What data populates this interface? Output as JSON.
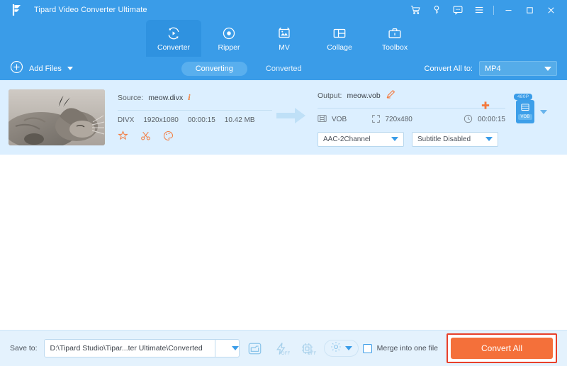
{
  "window": {
    "app_title": "Tipard Video Converter Ultimate",
    "logo_icon": "tipard-logo-icon",
    "controls": [
      {
        "name": "cart-icon",
        "glyph": "cart"
      },
      {
        "name": "key-icon",
        "glyph": "key"
      },
      {
        "name": "feedback-icon",
        "glyph": "chat"
      },
      {
        "name": "menu-icon",
        "glyph": "hamburger"
      },
      {
        "name": "minimize-icon",
        "glyph": "minimize"
      },
      {
        "name": "maximize-icon",
        "glyph": "maximize"
      },
      {
        "name": "close-icon",
        "glyph": "close"
      }
    ]
  },
  "nav": {
    "tabs": [
      {
        "label": "Converter",
        "icon": "converter-icon",
        "active": true
      },
      {
        "label": "Ripper",
        "icon": "ripper-icon",
        "active": false
      },
      {
        "label": "MV",
        "icon": "mv-icon",
        "active": false
      },
      {
        "label": "Collage",
        "icon": "collage-icon",
        "active": false
      },
      {
        "label": "Toolbox",
        "icon": "toolbox-icon",
        "active": false
      }
    ]
  },
  "toolbar": {
    "add_files_label": "Add Files",
    "add_files_icon": "plus-circle-icon",
    "segments": [
      {
        "label": "Converting",
        "active": true
      },
      {
        "label": "Converted",
        "active": false
      }
    ],
    "convert_all_to_label": "Convert All to:",
    "convert_all_format": "MP4"
  },
  "file_card": {
    "thumbnail_alt": "sleeping-cat-thumbnail",
    "source": {
      "label": "Source:",
      "filename": "meow.divx",
      "info_icon": "info-icon",
      "codec": "DIVX",
      "resolution": "1920x1080",
      "duration": "00:00:15",
      "filesize": "10.42 MB",
      "actions": [
        {
          "name": "edit-icon",
          "glyph": "wand"
        },
        {
          "name": "trim-icon",
          "glyph": "scissors"
        },
        {
          "name": "effect-icon",
          "glyph": "palette"
        }
      ]
    },
    "output": {
      "label": "Output:",
      "filename": "meow.vob",
      "rename_icon": "pencil-icon",
      "add_icon": "plus-orange-icon",
      "container": "VOB",
      "container_icon": "film-icon",
      "resolution": "720x480",
      "resolution_icon": "resize-icon",
      "duration": "00:00:15",
      "duration_icon": "clock-icon",
      "audio_track": "AAC-2Channel",
      "subtitle_track": "Subtitle Disabled"
    },
    "format_badge": {
      "quality": "480P",
      "format": "VOB",
      "icon": "format-preset-icon"
    }
  },
  "bottom_bar": {
    "save_to_label": "Save to:",
    "save_to_path": "D:\\Tipard Studio\\Tipar...ter Ultimate\\Converted",
    "open_folder_icon": "folder-icon",
    "speed_icon": "lightning-icon",
    "speed_state": "OFF",
    "gpu_icon": "gpu-chip-icon",
    "gpu_state": "OFF",
    "settings_icon": "gear-icon",
    "merge_label": "Merge into one file",
    "merge_checked": false,
    "convert_all_button": "Convert All"
  },
  "colors": {
    "header_blue": "#3a9ce8",
    "active_tab_blue": "#2f92e0",
    "card_blue": "#dcefff",
    "bottom_blue": "#e4f2fd",
    "accent_orange": "#f4703a",
    "highlight_red": "#e8402a"
  }
}
